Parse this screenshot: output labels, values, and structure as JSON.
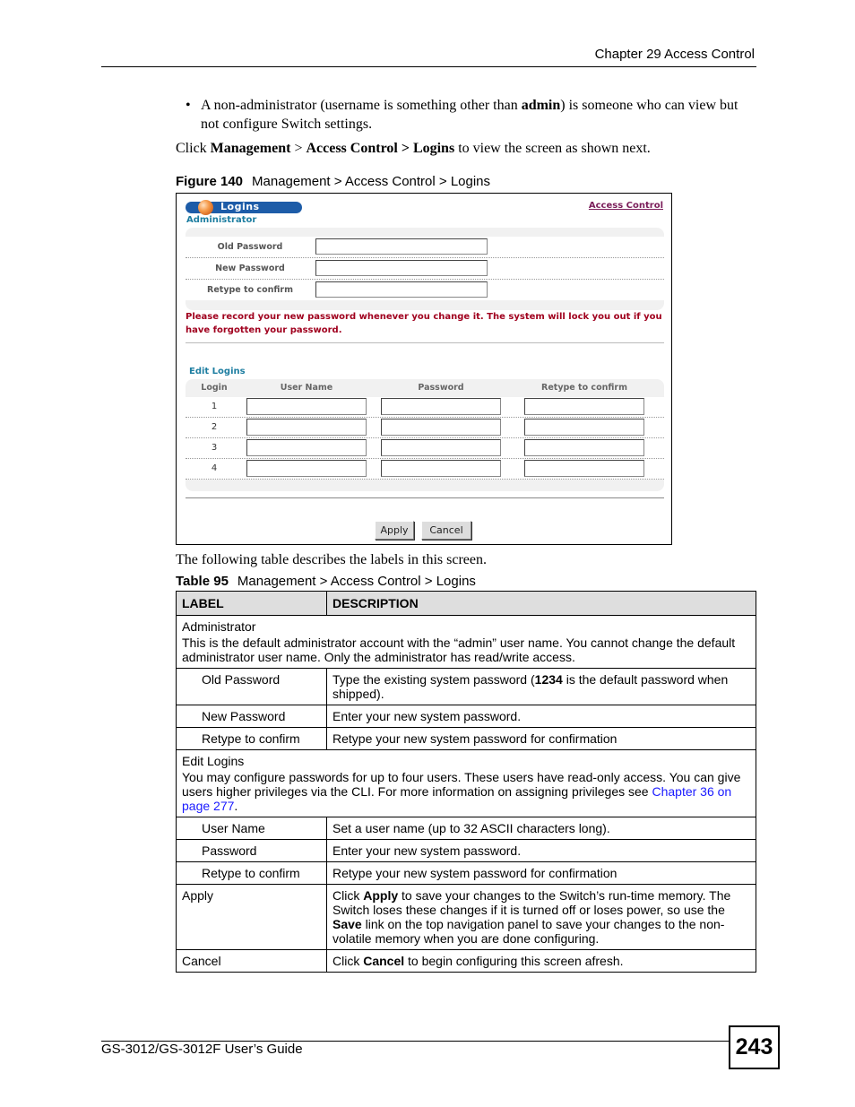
{
  "header": {
    "chapter": "Chapter 29 Access Control"
  },
  "intro": {
    "bullet": {
      "symbol": "•",
      "pre": "A non-administrator (username is something other than ",
      "bold": "admin",
      "post": ") is someone who can view but not configure Switch settings."
    },
    "click": {
      "pre": "Click ",
      "bold1": "Management",
      "sep1": " > ",
      "bold2": "Access Control > Logins",
      "post": " to view the screen as shown next."
    }
  },
  "figure": {
    "caption_num": "Figure 140",
    "caption_text": "Management > Access Control > Logins",
    "title": "Logins",
    "title_icon": "orange-ball-icon",
    "access_link": "Access Control",
    "admin_section": "Administrator",
    "admin_fields": [
      {
        "label": "Old Password",
        "value": ""
      },
      {
        "label": "New Password",
        "value": ""
      },
      {
        "label": "Retype to confirm",
        "value": ""
      }
    ],
    "warning": "Please record your new password whenever you change it. The system will lock you out if you have forgotten your password.",
    "edit_section": "Edit Logins",
    "edit_headers": [
      "Login",
      "User Name",
      "Password",
      "Retype to confirm"
    ],
    "edit_rows": [
      {
        "login": "1",
        "user": "",
        "password": "",
        "retype": ""
      },
      {
        "login": "2",
        "user": "",
        "password": "",
        "retype": ""
      },
      {
        "login": "3",
        "user": "",
        "password": "",
        "retype": ""
      },
      {
        "login": "4",
        "user": "",
        "password": "",
        "retype": ""
      }
    ],
    "apply_label": "Apply",
    "cancel_label": "Cancel"
  },
  "following": "The following table describes the labels in this screen.",
  "table": {
    "caption_num": "Table 95",
    "caption_text": "Management > Access Control > Logins",
    "headers": [
      "LABEL",
      "DESCRIPTION"
    ],
    "admin_title": "Administrator",
    "admin_desc": "This is the default administrator account with the “admin” user name. You cannot change the default administrator user name. Only the administrator has read/write access.",
    "rows_admin": [
      {
        "label": "Old Password",
        "pre": "Type the existing system password (",
        "bold": "1234",
        "post": " is the default password when shipped)."
      },
      {
        "label": "New Password",
        "pre": "Enter your new system password.",
        "bold": "",
        "post": ""
      },
      {
        "label": "Retype to confirm",
        "pre": "Retype your new system password for confirmation",
        "bold": "",
        "post": ""
      }
    ],
    "edit_title": "Edit Logins",
    "edit_desc": "You may configure passwords for up to four users. These users have read-only access. You can give users higher privileges via the CLI. For more information on assigning privileges see ",
    "edit_link": "Chapter 36 on page 277",
    "edit_desc_end": ".",
    "rows_edit": [
      {
        "label": "User Name",
        "desc": "Set a user name (up to 32 ASCII characters long)."
      },
      {
        "label": "Password",
        "desc": "Enter your new system password."
      },
      {
        "label": "Retype to confirm",
        "desc": "Retype your new system password for confirmation"
      }
    ],
    "apply": {
      "label": "Apply",
      "pre": "Click ",
      "bold": "Apply",
      "mid": " to save your changes to the Switch’s run-time memory. The Switch loses these changes if it is turned off or loses power, so use the ",
      "bold2": "Save",
      "post": " link on the top navigation panel to save your changes to the non-volatile memory when you are done configuring."
    },
    "cancel": {
      "label": "Cancel",
      "pre": "Click ",
      "bold": "Cancel",
      "post": " to begin configuring this screen afresh."
    }
  },
  "footer": {
    "guide": "GS-3012/GS-3012F User’s Guide",
    "page": "243"
  }
}
